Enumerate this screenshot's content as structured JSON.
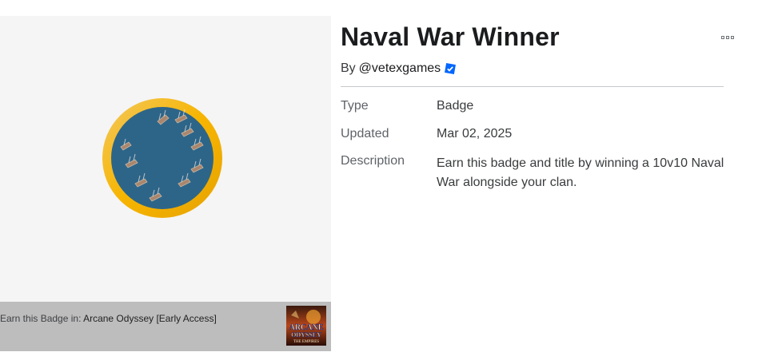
{
  "badge": {
    "name": "Naval War Winner",
    "creator_prefix": "By",
    "creator": "@vetexgames",
    "verified": true,
    "icon_colors": {
      "ring": "#f7b500",
      "inner": "#2d6589"
    }
  },
  "details": [
    {
      "label": "Type",
      "value": "Badge"
    },
    {
      "label": "Updated",
      "value": "Mar 02, 2025"
    },
    {
      "label": "Description",
      "value": "Earn this badge and title by winning a 10v10 Naval War alongside your clan."
    }
  ],
  "earn": {
    "prefix": "Earn this Badge in:",
    "game": "Arcane Odyssey [Early Access]",
    "thumb_text_top": "ARCANE",
    "thumb_text_mid": "ODYSSEY",
    "thumb_text_bottom": "THE EMPIRES"
  },
  "icons": {
    "more": "more-options-icon",
    "verified": "verified-badge-icon"
  }
}
